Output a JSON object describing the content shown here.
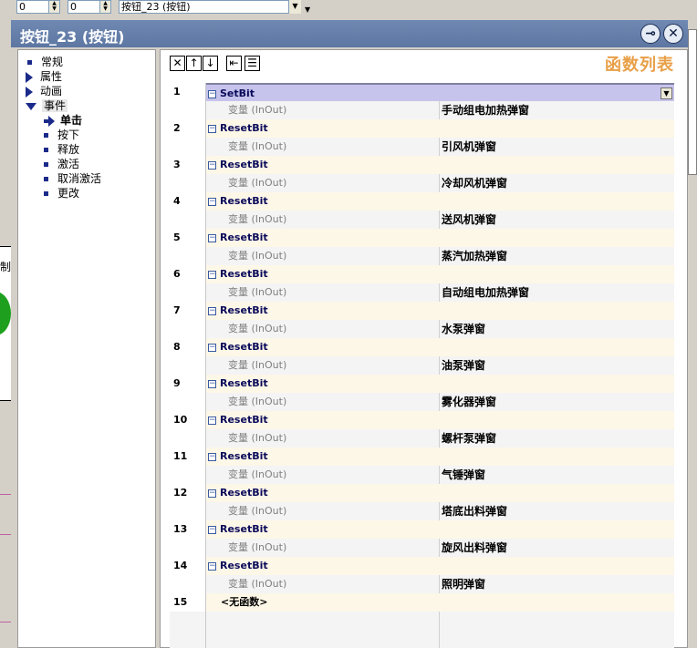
{
  "toolbar": {
    "spin1_value": "0",
    "spin2_value": "0",
    "object_select": "按钮_23 (按钮)"
  },
  "window": {
    "title": "按钮_23 (按钮)",
    "pin_icon": "pin-icon",
    "close_icon": "close-icon"
  },
  "left_fragment": {
    "text": "制"
  },
  "tree": {
    "items": [
      {
        "label": "常规",
        "type": "leaf"
      },
      {
        "label": "属性",
        "type": "collapsed"
      },
      {
        "label": "动画",
        "type": "collapsed"
      },
      {
        "label": "事件",
        "type": "expanded"
      },
      {
        "label": "单击",
        "type": "selected-child"
      },
      {
        "label": "按下",
        "type": "child"
      },
      {
        "label": "释放",
        "type": "child"
      },
      {
        "label": "激活",
        "type": "child"
      },
      {
        "label": "取消激活",
        "type": "child"
      },
      {
        "label": "更改",
        "type": "child"
      }
    ]
  },
  "pane": {
    "title": "函数列表",
    "tools": [
      "delete-icon",
      "move-up-icon",
      "move-down-icon",
      "outdent-icon",
      "indent-icon"
    ]
  },
  "functions": [
    {
      "num": "1",
      "name": "SetBit",
      "param_label": "变量 (InOut)",
      "param_value": "手动组电加热弹窗"
    },
    {
      "num": "2",
      "name": "ResetBit",
      "param_label": "变量 (InOut)",
      "param_value": "引风机弹窗"
    },
    {
      "num": "3",
      "name": "ResetBit",
      "param_label": "变量 (InOut)",
      "param_value": "冷却风机弹窗"
    },
    {
      "num": "4",
      "name": "ResetBit",
      "param_label": "变量 (InOut)",
      "param_value": "送风机弹窗"
    },
    {
      "num": "5",
      "name": "ResetBit",
      "param_label": "变量 (InOut)",
      "param_value": "蒸汽加热弹窗"
    },
    {
      "num": "6",
      "name": "ResetBit",
      "param_label": "变量 (InOut)",
      "param_value": "自动组电加热弹窗"
    },
    {
      "num": "7",
      "name": "ResetBit",
      "param_label": "变量 (InOut)",
      "param_value": "水泵弹窗"
    },
    {
      "num": "8",
      "name": "ResetBit",
      "param_label": "变量 (InOut)",
      "param_value": "油泵弹窗"
    },
    {
      "num": "9",
      "name": "ResetBit",
      "param_label": "变量 (InOut)",
      "param_value": "雾化器弹窗"
    },
    {
      "num": "10",
      "name": "ResetBit",
      "param_label": "变量 (InOut)",
      "param_value": "螺杆泵弹窗"
    },
    {
      "num": "11",
      "name": "ResetBit",
      "param_label": "变量 (InOut)",
      "param_value": "气锤弹窗"
    },
    {
      "num": "12",
      "name": "ResetBit",
      "param_label": "变量 (InOut)",
      "param_value": "塔底出料弹窗"
    },
    {
      "num": "13",
      "name": "ResetBit",
      "param_label": "变量 (InOut)",
      "param_value": "旋风出料弹窗"
    },
    {
      "num": "14",
      "name": "ResetBit",
      "param_label": "变量 (InOut)",
      "param_value": "照明弹窗"
    }
  ],
  "last_row": {
    "num": "15",
    "text": "<无函数>"
  },
  "colors": {
    "title_bar": "#6f89b3",
    "selected_row": "#c6c3ec",
    "function_row": "#fdf7e8",
    "pane_title": "#e8a048",
    "tree_icon": "#1a2a8a"
  }
}
